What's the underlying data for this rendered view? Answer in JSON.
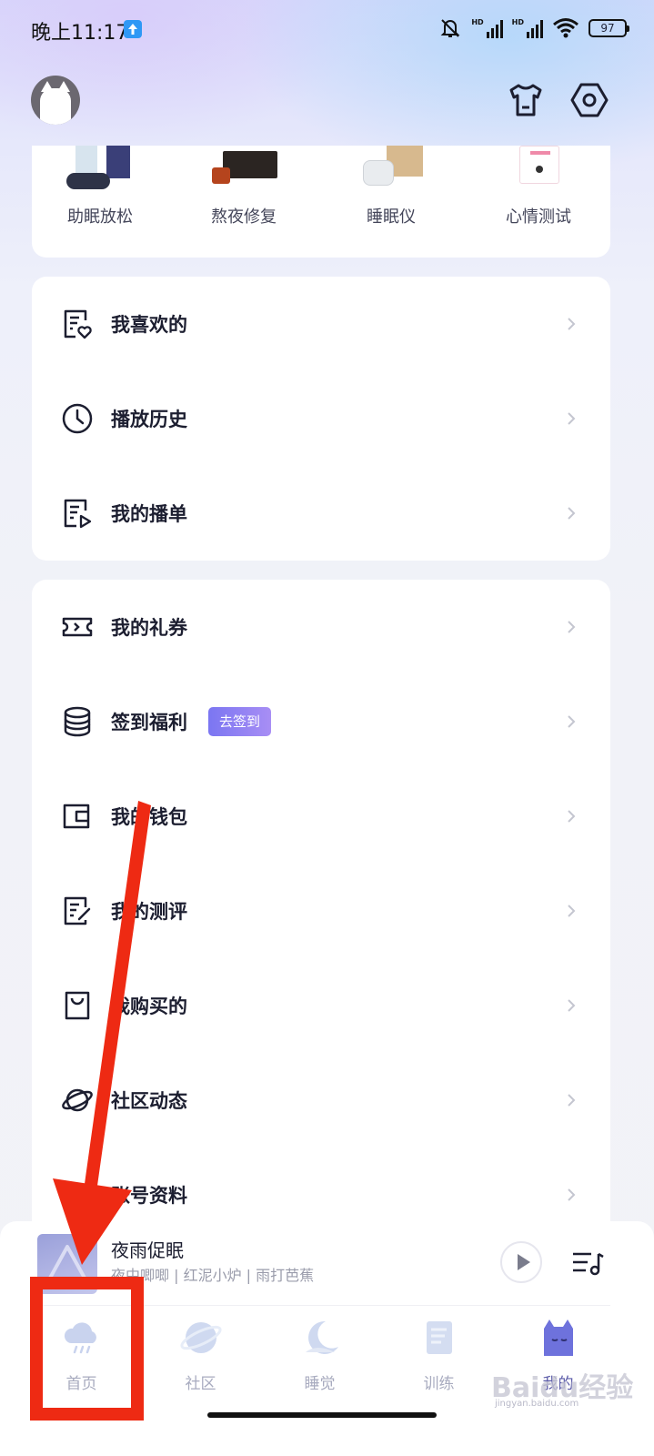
{
  "status_bar": {
    "time": "晚上11:17",
    "battery": "97",
    "network": "HD"
  },
  "header": {
    "avatar": "cat-avatar",
    "icons": [
      "shirt-icon",
      "settings-hexagon-icon"
    ]
  },
  "shop": {
    "items": [
      {
        "label": "助眠放松"
      },
      {
        "label": "熬夜修复"
      },
      {
        "label": "睡眠仪"
      },
      {
        "label": "心情测试"
      }
    ]
  },
  "menu_group_1": [
    {
      "label": "我喜欢的",
      "icon": "favorite-list-icon"
    },
    {
      "label": "播放历史",
      "icon": "clock-icon"
    },
    {
      "label": "我的播单",
      "icon": "playlist-doc-icon"
    }
  ],
  "menu_group_2": [
    {
      "label": "我的礼券",
      "icon": "ticket-icon"
    },
    {
      "label": "签到福利",
      "icon": "coins-icon",
      "badge": "去签到"
    },
    {
      "label": "我的钱包",
      "icon": "wallet-icon"
    },
    {
      "label": "我的测评",
      "icon": "edit-doc-icon"
    },
    {
      "label": "我购买的",
      "icon": "shopping-bag-icon"
    },
    {
      "label": "社区动态",
      "icon": "planet-icon"
    },
    {
      "label": "账号资料",
      "icon": "profile-icon"
    }
  ],
  "player": {
    "title": "夜雨促眠",
    "tags": "夜中唧唧 | 红泥小炉 | 雨打芭蕉"
  },
  "tabs": [
    {
      "label": "首页",
      "icon": "rain-cloud-icon"
    },
    {
      "label": "社区",
      "icon": "planet-icon"
    },
    {
      "label": "睡觉",
      "icon": "moon-icon"
    },
    {
      "label": "训练",
      "icon": "notebook-icon"
    },
    {
      "label": "我的",
      "icon": "cat-icon",
      "active": true
    }
  ],
  "colors": {
    "accent": "#7b76f2",
    "annotation": "#ee2a13"
  },
  "watermark": {
    "text": "Baidu经验",
    "url_text": "jingyan.baidu.com"
  }
}
